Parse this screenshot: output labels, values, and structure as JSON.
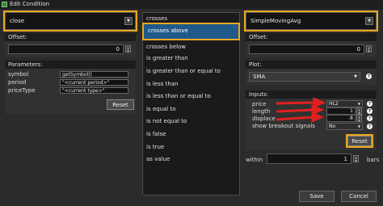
{
  "window": {
    "title": "Edit Condition"
  },
  "left": {
    "study_value": "close",
    "offset_label": "Offset:",
    "offset_value": "0",
    "params_label": "Parameters:",
    "params": [
      {
        "name": "symbol",
        "value": "getSymbol()"
      },
      {
        "name": "period",
        "value": "\"<current period>\""
      },
      {
        "name": "priceType",
        "value": "\"<current type>\""
      }
    ],
    "reset_label": "Reset"
  },
  "middle": {
    "items": [
      {
        "label": "crosses",
        "selected": false
      },
      {
        "label": "crosses above",
        "selected": true
      },
      {
        "label": "crosses below",
        "selected": false
      },
      {
        "label": "is greater than",
        "selected": false
      },
      {
        "label": "is greater than or equal to",
        "selected": false
      },
      {
        "label": "is less than",
        "selected": false
      },
      {
        "label": "is less than or equal to",
        "selected": false
      },
      {
        "label": "is equal to",
        "selected": false
      },
      {
        "label": "is not equal to",
        "selected": false
      },
      {
        "label": "is false",
        "selected": false
      },
      {
        "label": "is true",
        "selected": false
      },
      {
        "label": "as value",
        "selected": false
      }
    ]
  },
  "right": {
    "study_value": "SimpleMovingAvg",
    "offset_label": "Offset:",
    "offset_value": "0",
    "plot_label": "Plot:",
    "plot_value": "SMA",
    "inputs_label": "Inputs:",
    "inputs": [
      {
        "name": "price",
        "value": "HL2"
      },
      {
        "name": "length",
        "value": "1"
      },
      {
        "name": "displace",
        "value": "-8"
      },
      {
        "name": "show breakout signals",
        "value": "No"
      }
    ],
    "reset_label": "Reset",
    "within_label": "within",
    "within_value": "1",
    "bars_label": "bars"
  },
  "footer": {
    "save_label": "Save",
    "cancel_label": "Cancel"
  },
  "colors": {
    "highlight": "#e8a820",
    "selected_bg": "#1f5a8a",
    "arrow_red": "#e02020"
  },
  "icons": [
    "app-icon",
    "chevron-down-icon",
    "spin-arrows-icon",
    "help-icon",
    "red-arrow-icon"
  ]
}
